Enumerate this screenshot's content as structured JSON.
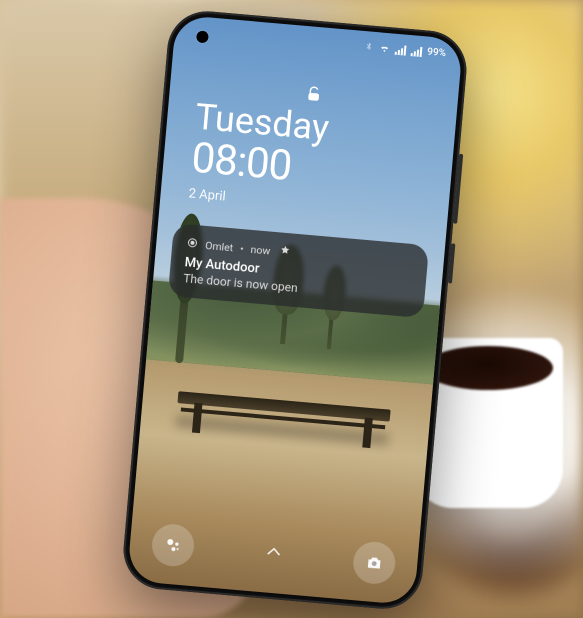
{
  "status_bar": {
    "battery_text": "99%"
  },
  "lockscreen": {
    "day": "Tuesday",
    "time": "08:00",
    "date": "2 April"
  },
  "notification": {
    "app_name": "Omlet",
    "timestamp": "now",
    "title": "My Autodoor",
    "body": "The door is now open"
  }
}
